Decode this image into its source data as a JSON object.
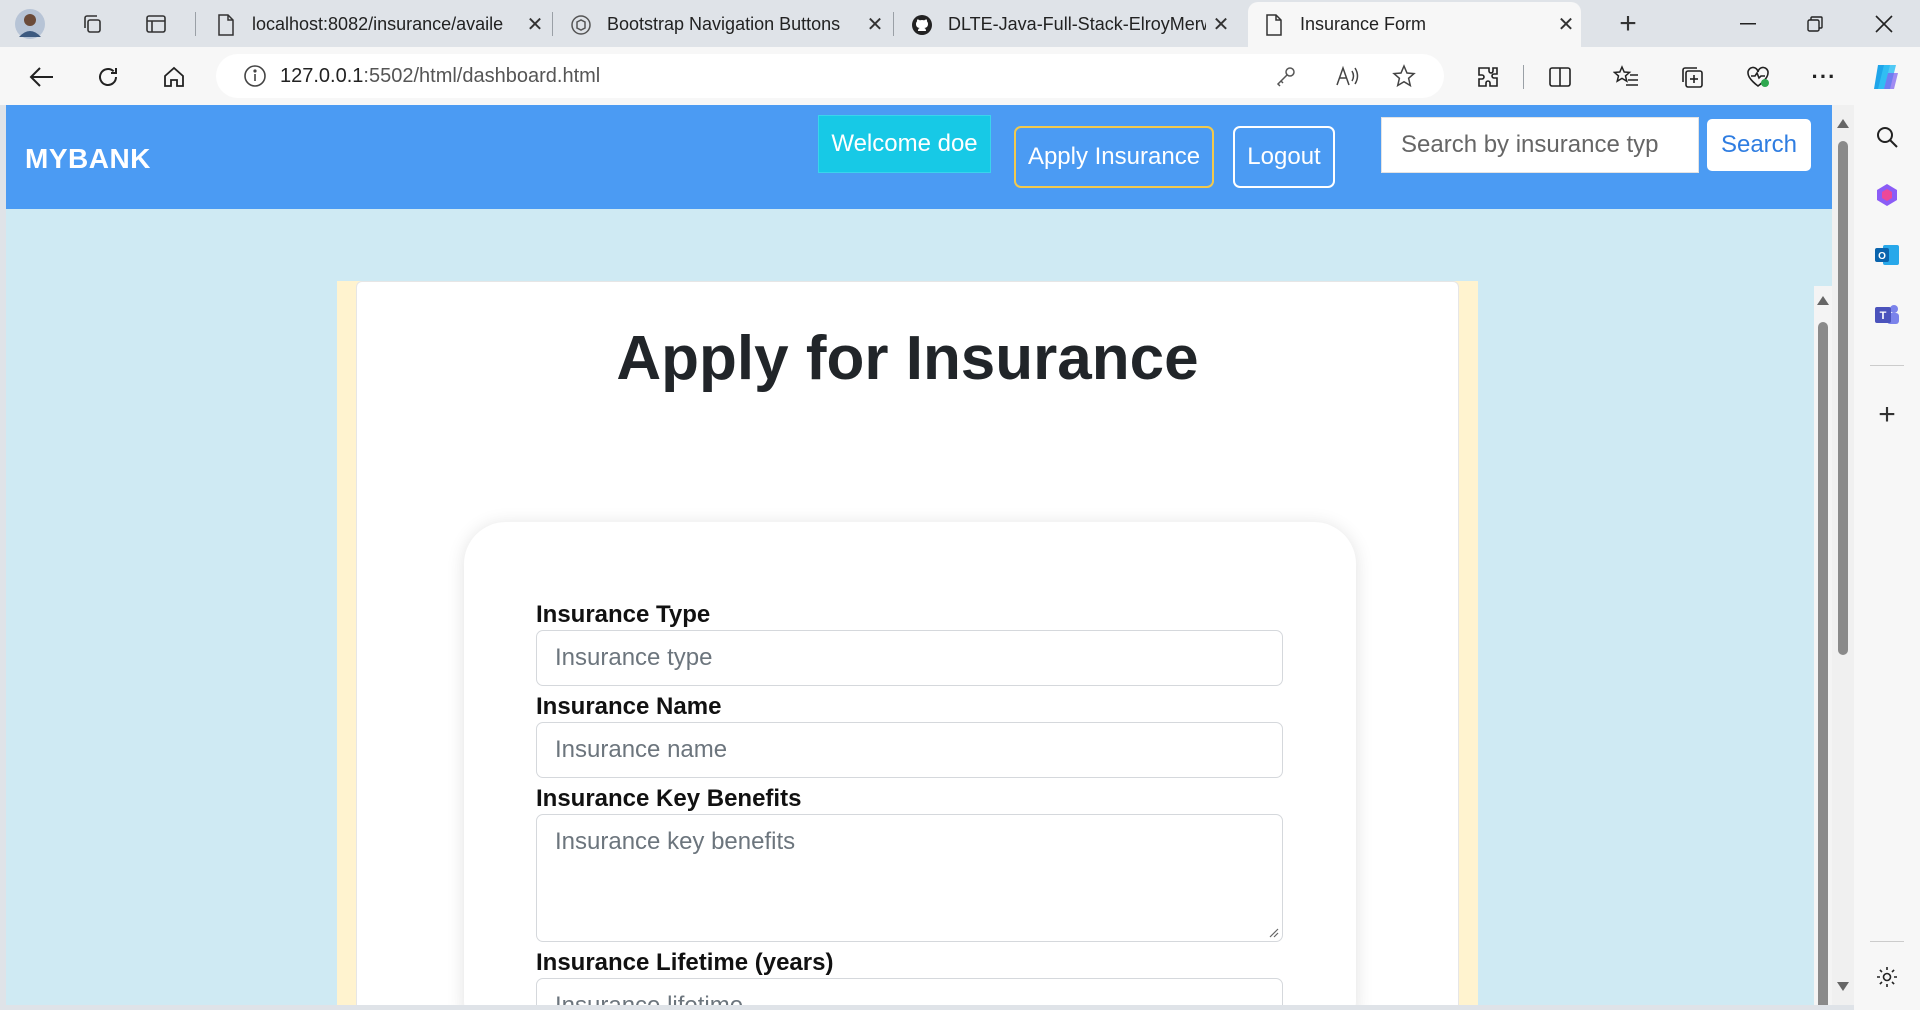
{
  "browser": {
    "tabs": [
      {
        "title": "localhost:8082/insurance/availe",
        "icon": "page-icon",
        "active": false
      },
      {
        "title": "Bootstrap Navigation Buttons",
        "icon": "chatgpt-icon",
        "active": false
      },
      {
        "title": "DLTE-Java-Full-Stack-ElroyMerw",
        "icon": "github-icon",
        "active": false
      },
      {
        "title": "Insurance Form",
        "icon": "page-icon",
        "active": true
      }
    ],
    "url_host": "127.0.0.1",
    "url_path": ":5502/html/dashboard.html"
  },
  "navbar": {
    "brand": "MYBANK",
    "welcome": "Welcome doe",
    "apply_label": "Apply Insurance",
    "logout_label": "Logout",
    "search_placeholder": "Search by insurance typ",
    "search_label": "Search"
  },
  "main": {
    "title": "Apply for Insurance"
  },
  "form": {
    "type_label": "Insurance Type",
    "type_placeholder": "Insurance type",
    "name_label": "Insurance Name",
    "name_placeholder": "Insurance name",
    "benefits_label": "Insurance Key Benefits",
    "benefits_placeholder": "Insurance key benefits",
    "lifetime_label": "Insurance Lifetime (years)",
    "lifetime_placeholder": "Insurance lifetime"
  },
  "colors": {
    "navbar": "#4b9bf3",
    "page_bg": "#cfeaf3",
    "welcome_bg": "#17c9e6",
    "container_bg": "#fff3cf"
  }
}
